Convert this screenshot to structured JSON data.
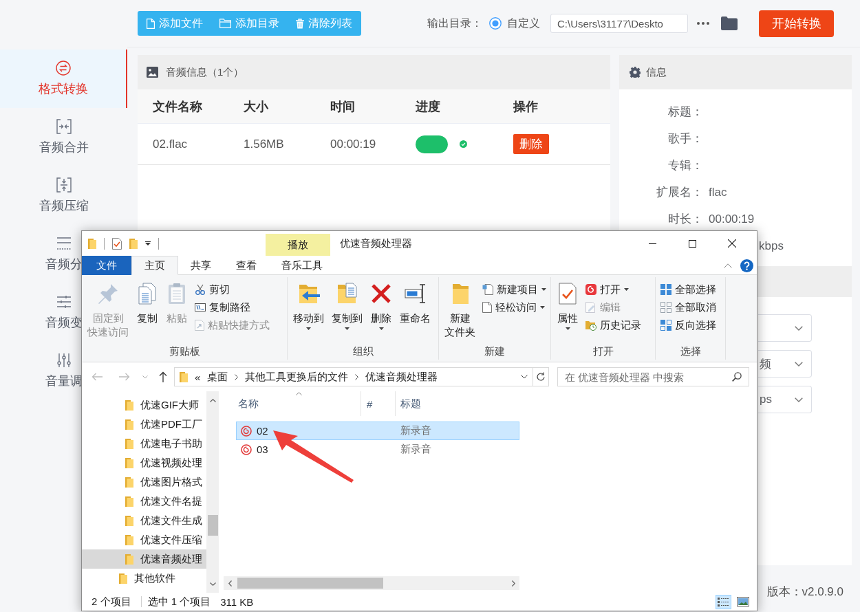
{
  "sidebar": {
    "items": [
      {
        "label": "格式转换",
        "selected": true
      },
      {
        "label": "音频合并",
        "selected": false
      },
      {
        "label": "音频压缩",
        "selected": false
      },
      {
        "label": "音频分",
        "selected": false
      },
      {
        "label": "音频变",
        "selected": false
      },
      {
        "label": "音量调",
        "selected": false
      }
    ]
  },
  "toolbar": {
    "buttons": [
      "添加文件",
      "添加目录",
      "清除列表"
    ],
    "output_label": "输出目录：",
    "output_option": {
      "label": "自定义",
      "selected": true
    },
    "output_path": "C:\\Users\\31177\\Deskto",
    "start_button": "开始转换"
  },
  "file_panel": {
    "title": "音频信息（1个）",
    "columns": [
      "文件名称",
      "大小",
      "时间",
      "进度",
      "操作"
    ],
    "rows": [
      {
        "name": "02.flac",
        "size": "1.56MB",
        "time": "00:00:19",
        "progress": {
          "level": 1,
          "done": true
        },
        "action": "删除"
      }
    ]
  },
  "info_panel": {
    "title": "信息",
    "fields": [
      {
        "label": "标题："
      },
      {
        "label": "歌手："
      },
      {
        "label": "专辑："
      },
      {
        "label": "扩展名：",
        "value": "flac"
      },
      {
        "label": "时长：",
        "value": "00:00:19"
      },
      {
        "value": "kbps"
      }
    ],
    "selects": [
      {
        "kind": "dropdown"
      },
      {
        "kind": "dropdown",
        "value": "频"
      },
      {
        "kind": "dropdown",
        "value": "ps"
      }
    ]
  },
  "version": "版本：v2.0.9.0",
  "explorer": {
    "contextual_tab": "播放",
    "title": "优速音频处理器",
    "tabs": [
      {
        "label": "文件",
        "kind": "menu",
        "selected": false
      },
      {
        "label": "主页",
        "kind": "tab",
        "selected": true
      },
      {
        "label": "共享",
        "kind": "tab",
        "selected": false
      },
      {
        "label": "查看",
        "kind": "tab",
        "selected": false
      },
      {
        "label": "音乐工具",
        "kind": "tab",
        "selected": false
      }
    ],
    "ribbon": {
      "groups": [
        {
          "label": "剪贴板",
          "items": [
            {
              "kind": "large",
              "lines": [
                "固定到",
                "快速访问"
              ],
              "disabled": true,
              "menu": false
            },
            {
              "kind": "large",
              "lines": [
                "复制"
              ],
              "disabled": false,
              "menu": false
            },
            {
              "kind": "large",
              "lines": [
                "粘贴"
              ],
              "disabled": true,
              "menu": false
            },
            {
              "kind": "stack",
              "items": [
                {
                  "label": "剪切",
                  "disabled": false,
                  "menu": false
                },
                {
                  "label": "复制路径",
                  "disabled": false,
                  "menu": false
                },
                {
                  "label": "粘贴快捷方式",
                  "disabled": true,
                  "menu": false
                }
              ]
            }
          ]
        },
        {
          "label": "组织",
          "items": [
            {
              "kind": "large",
              "lines": [
                "移动到"
              ],
              "disabled": false,
              "menu": true
            },
            {
              "kind": "large",
              "lines": [
                "复制到"
              ],
              "disabled": false,
              "menu": true
            },
            {
              "kind": "large",
              "lines": [
                "删除"
              ],
              "disabled": false,
              "menu": true
            },
            {
              "kind": "large",
              "lines": [
                "重命名"
              ],
              "disabled": false,
              "menu": false
            }
          ]
        },
        {
          "label": "新建",
          "items": [
            {
              "kind": "large",
              "lines": [
                "新建",
                "文件夹"
              ],
              "disabled": false,
              "menu": false
            },
            {
              "kind": "stack",
              "items": [
                {
                  "label": "新建项目",
                  "disabled": false,
                  "menu": true
                },
                {
                  "label": "轻松访问",
                  "disabled": false,
                  "menu": true
                }
              ]
            }
          ]
        },
        {
          "label": "打开",
          "items": [
            {
              "kind": "large",
              "lines": [
                "属性"
              ],
              "disabled": false,
              "menu": true
            },
            {
              "kind": "stack",
              "items": [
                {
                  "label": "打开",
                  "disabled": false,
                  "menu": true
                },
                {
                  "label": "编辑",
                  "disabled": true,
                  "menu": false
                },
                {
                  "label": "历史记录",
                  "disabled": false,
                  "menu": false
                }
              ]
            }
          ]
        },
        {
          "label": "选择",
          "items": [
            {
              "kind": "stack",
              "items": [
                {
                  "label": "全部选择",
                  "disabled": false,
                  "menu": false
                },
                {
                  "label": "全部取消",
                  "disabled": false,
                  "menu": false
                },
                {
                  "label": "反向选择",
                  "disabled": false,
                  "menu": false
                }
              ]
            }
          ]
        }
      ]
    },
    "address": {
      "overflow": "«",
      "crumbs": [
        "桌面",
        "其他工具更换后的文件",
        "优速音频处理器"
      ]
    },
    "search": {
      "placeholder": "在 优速音频处理器 中搜索"
    },
    "nav_tree": [
      {
        "children": [
          {
            "label": "优速GIF大师",
            "selected": false
          },
          {
            "label": "优速PDF工厂",
            "selected": false
          },
          {
            "label": "优速电子书助",
            "selected": false
          },
          {
            "label": "优速视频处理",
            "selected": false
          },
          {
            "label": "优速图片格式",
            "selected": false
          },
          {
            "label": "优速文件名提",
            "selected": false
          },
          {
            "label": "优速文件生成",
            "selected": false
          },
          {
            "label": "优速文件压缩",
            "selected": false
          },
          {
            "label": "优速音频处理",
            "selected": true
          }
        ]
      },
      {
        "label": "其他软件",
        "selected": false
      }
    ],
    "list": {
      "columns": [
        {
          "label": "名称",
          "sorted": true
        },
        {
          "label": "#",
          "sorted": false
        },
        {
          "label": "标题",
          "sorted": false
        }
      ],
      "rows": [
        {
          "name": "02",
          "title": "新录音",
          "selected": true
        },
        {
          "name": "03",
          "title": "新录音",
          "selected": false
        }
      ]
    },
    "status": {
      "count": "2 个项目",
      "selection": "选中 1 个项目",
      "size": "311 KB"
    },
    "views": [
      {
        "selected": true
      },
      {
        "selected": false
      }
    ]
  }
}
